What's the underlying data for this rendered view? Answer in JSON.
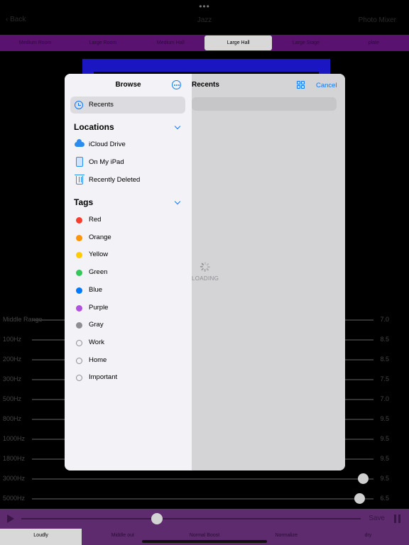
{
  "background_app": {
    "top_dots": "•••",
    "nav": {
      "back_label": "Back",
      "title": "Jazz",
      "right_action": "Photo Mixer"
    },
    "presets": [
      "Medium Room",
      "Large Room",
      "Medium Hall",
      "Large Hall",
      "Large Stage",
      "plate"
    ],
    "active_preset": "Large Hall",
    "eq_header": {
      "left": "Middle Range",
      "right": "7.0"
    },
    "eq_bands": [
      {
        "label": "100Hz",
        "value": "8.5"
      },
      {
        "label": "200Hz",
        "value": "8.5"
      },
      {
        "label": "300Hz",
        "value": "7.5"
      },
      {
        "label": "500Hz",
        "value": "7.0"
      },
      {
        "label": "800Hz",
        "value": "9.5"
      },
      {
        "label": "1000Hz",
        "value": "9.5"
      },
      {
        "label": "1800Hz",
        "value": "9.5"
      },
      {
        "label": "3000Hz",
        "value": "9.5"
      },
      {
        "label": "5000Hz",
        "value": "6.5"
      }
    ],
    "transport": {
      "save_label": "Save",
      "progress": 0.4
    },
    "modes": [
      "Loudly",
      "Middle out",
      "Normal Boost",
      "Normalize",
      "dry"
    ],
    "active_mode": "Loudly"
  },
  "picker": {
    "sidebar": {
      "title": "Browse",
      "recents_label": "Recents",
      "locations_title": "Locations",
      "locations": [
        {
          "label": "iCloud Drive",
          "icon": "icloud-icon"
        },
        {
          "label": "On My iPad",
          "icon": "ipad-icon"
        },
        {
          "label": "Recently Deleted",
          "icon": "trash-icon"
        }
      ],
      "tags_title": "Tags",
      "tags": [
        {
          "label": "Red",
          "color": "#ff3b30"
        },
        {
          "label": "Orange",
          "color": "#ff9500"
        },
        {
          "label": "Yellow",
          "color": "#ffcc00"
        },
        {
          "label": "Green",
          "color": "#34c759"
        },
        {
          "label": "Blue",
          "color": "#007aff"
        },
        {
          "label": "Purple",
          "color": "#af52de"
        },
        {
          "label": "Gray",
          "color": "#8e8e93"
        },
        {
          "label": "Work",
          "color": ""
        },
        {
          "label": "Home",
          "color": ""
        },
        {
          "label": "Important",
          "color": ""
        }
      ]
    },
    "content": {
      "title": "Recents",
      "cancel_label": "Cancel",
      "loading_text": "LOADING"
    }
  },
  "colors": {
    "accent": "#0a7aff",
    "preset_bar": "#5a1270",
    "transport_bar": "#5d2b6e",
    "blue_panel": "#1a17c2"
  }
}
